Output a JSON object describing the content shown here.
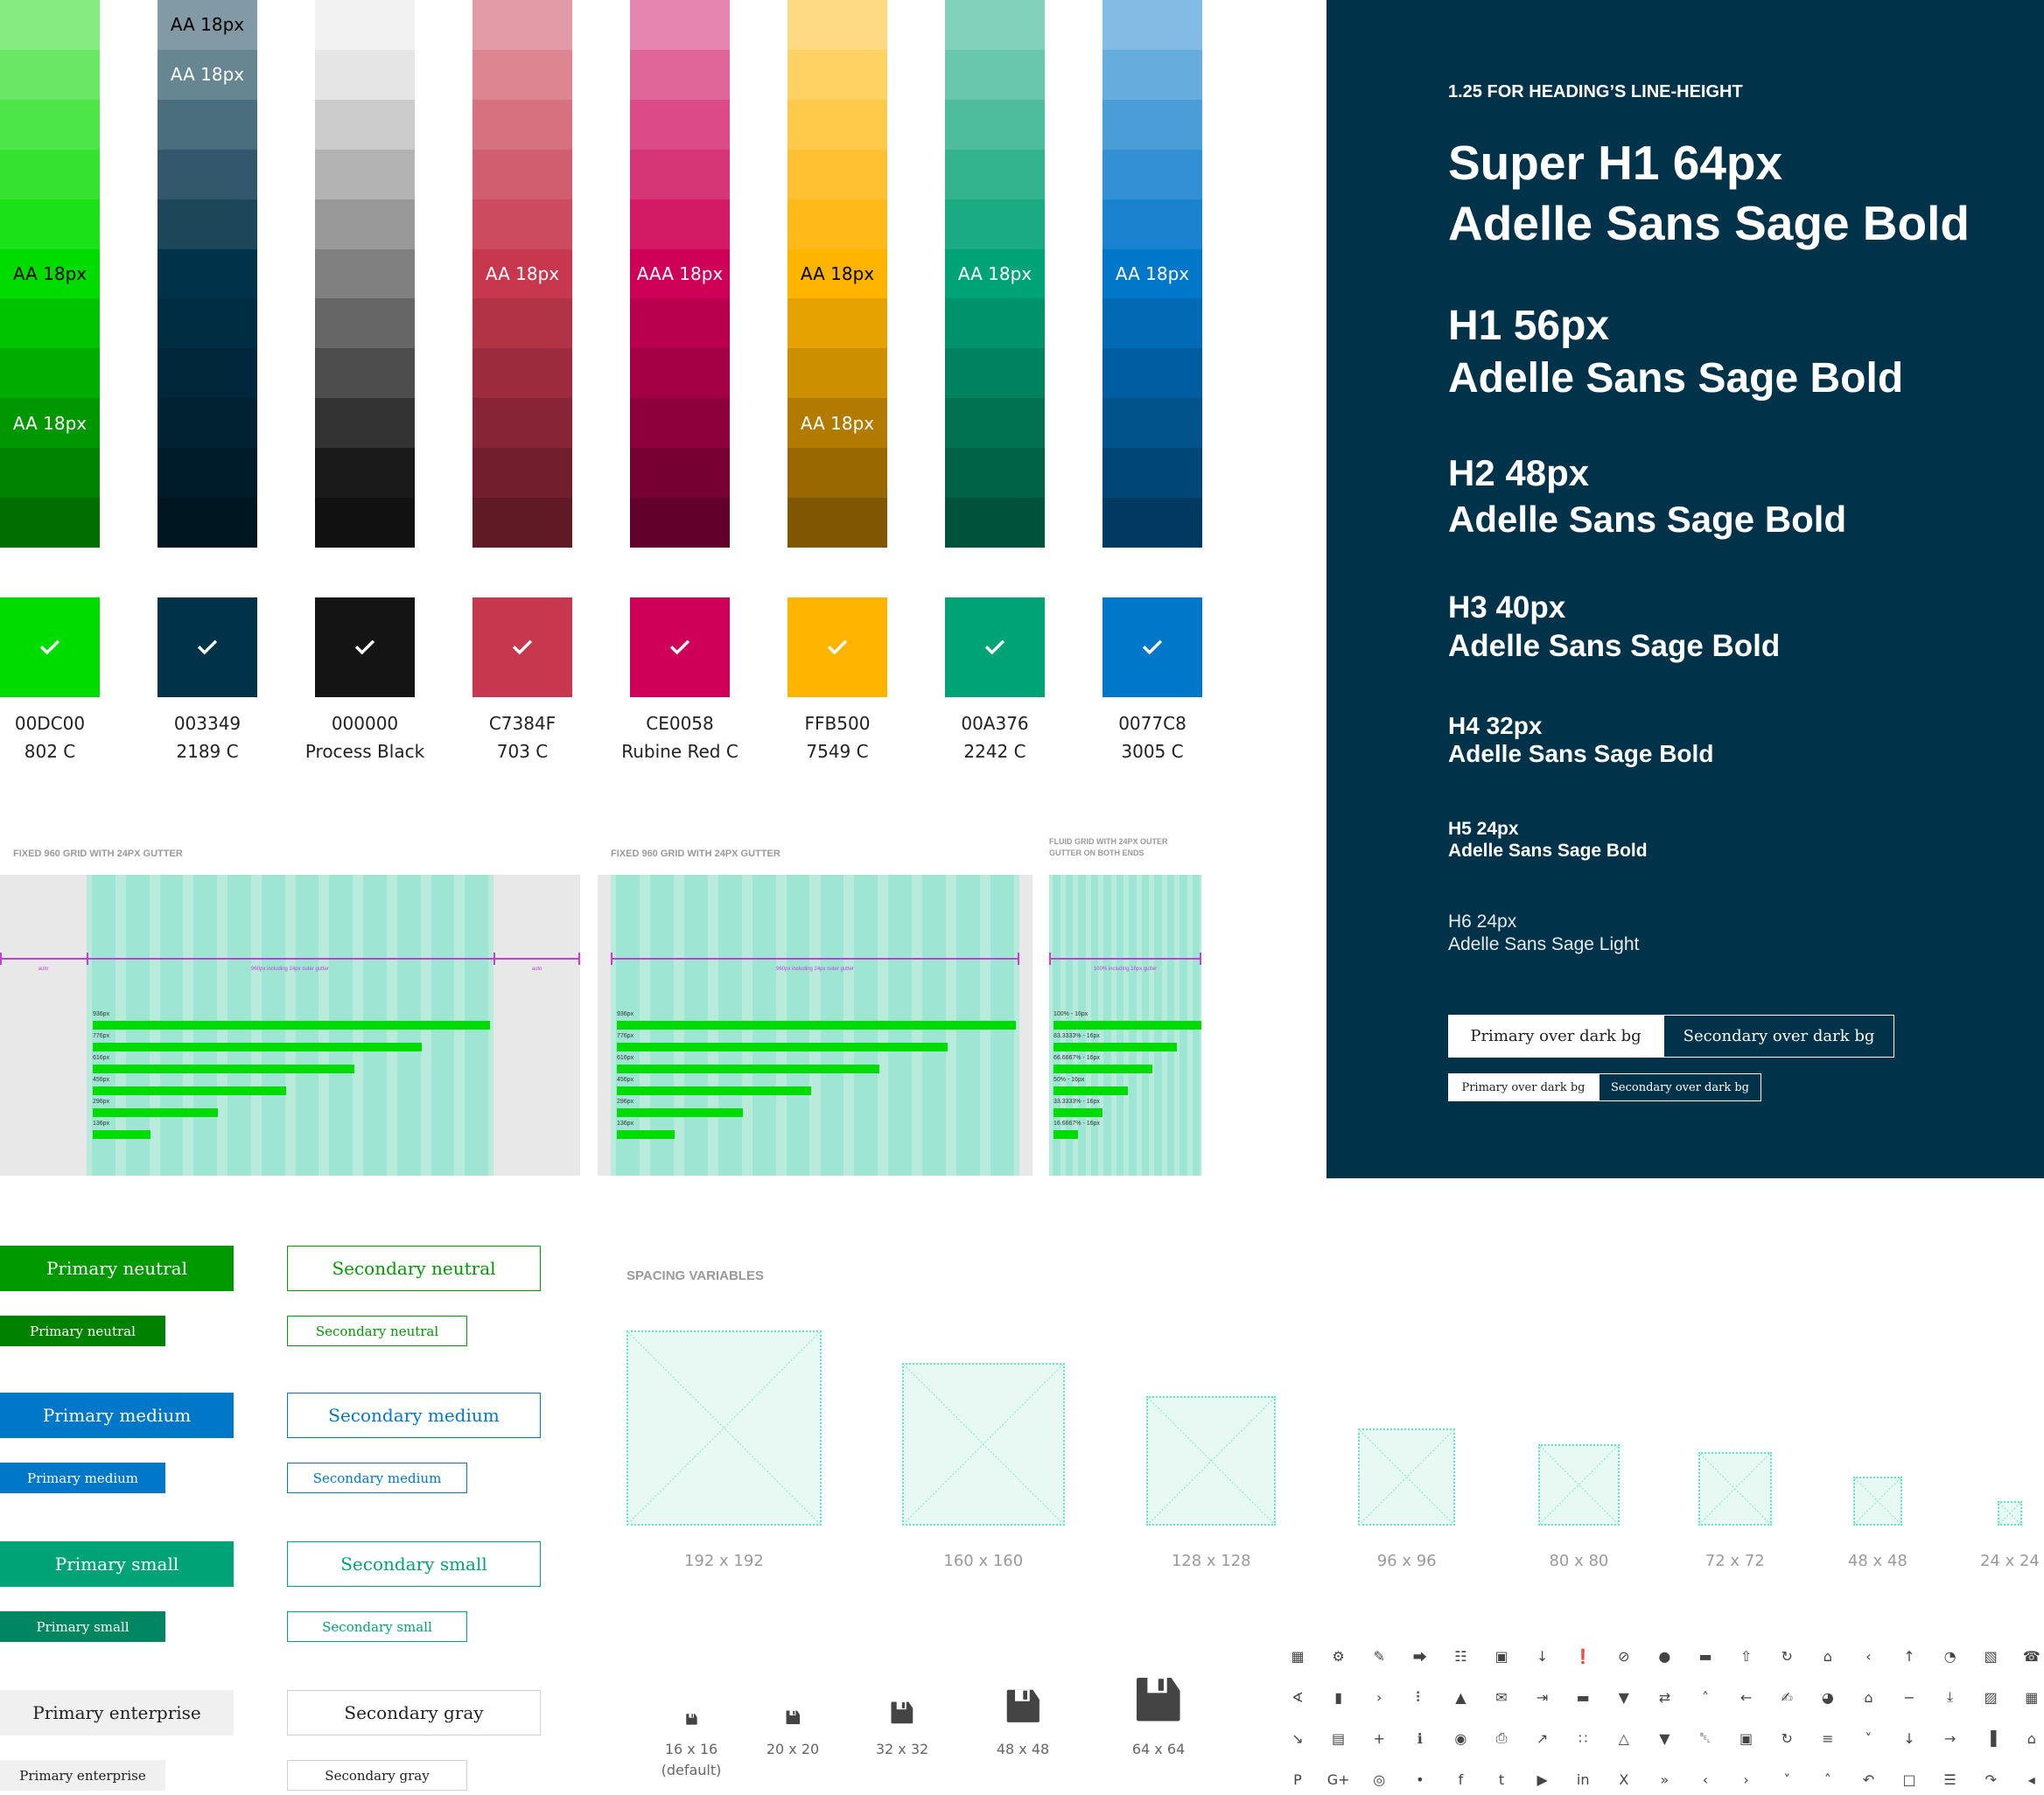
{
  "palettes": [
    {
      "name": "green",
      "steps": [
        "#86ec81",
        "#6ae765",
        "#4de648",
        "#34e22f",
        "#1be217",
        "#00dc00",
        "#00c400",
        "#00ac00",
        "#009700",
        "#008300",
        "#006e00"
      ],
      "labels": {
        "5": {
          "text": "AA 18px",
          "color": "#000000"
        },
        "8": {
          "text": "AA 18px",
          "color": "#ffffff"
        }
      },
      "main": "#00dc00",
      "hex": "00DC00",
      "pantone": "802 C"
    },
    {
      "name": "navy",
      "steps": [
        "#819aa6",
        "#668692",
        "#4b6e7e",
        "#34586b",
        "#1d4659",
        "#003349",
        "#002d42",
        "#00273a",
        "#002233",
        "#001c2b",
        "#001722"
      ],
      "labels": {
        "0": {
          "text": "AA 18px",
          "color": "#000000"
        },
        "1": {
          "text": "AA 18px",
          "color": "#ffffff"
        }
      },
      "main": "#003349",
      "hex": "003349",
      "pantone": "2189 C"
    },
    {
      "name": "gray",
      "steps": [
        "#f2f2f2",
        "#e5e5e5",
        "#cccccc",
        "#b3b3b3",
        "#999999",
        "#808080",
        "#666666",
        "#4d4d4d",
        "#333333",
        "#1a1a1a",
        "#111111"
      ],
      "labels": {},
      "main": "#141414",
      "hex": "000000",
      "pantone": "Process Black"
    },
    {
      "name": "red",
      "steps": [
        "#e39ca7",
        "#dd8692",
        "#d67280",
        "#d15e6e",
        "#cc4b5f",
        "#c7384f",
        "#b13346",
        "#9c2b3e",
        "#872436",
        "#731e2c",
        "#5f1a26"
      ],
      "labels": {
        "5": {
          "text": "AA 18px",
          "color": "#ffffff"
        }
      },
      "main": "#c7384f",
      "hex": "C7384F",
      "pantone": "703 C"
    },
    {
      "name": "rubine",
      "steps": [
        "#e685ae",
        "#e06699",
        "#db4b88",
        "#d63676",
        "#d21a65",
        "#ce0058",
        "#b8004f",
        "#a30045",
        "#8d003c",
        "#770033",
        "#62002b"
      ],
      "labels": {
        "5": {
          "text": "AAA 18px",
          "color": "#ffffff"
        }
      },
      "main": "#ce0058",
      "hex": "CE0058",
      "pantone": "Rubine Red C"
    },
    {
      "name": "yellow",
      "steps": [
        "#ffda85",
        "#ffd264",
        "#ffc94a",
        "#ffc132",
        "#ffba19",
        "#ffb500",
        "#e5a200",
        "#cc8f00",
        "#b27b00",
        "#996800",
        "#805700"
      ],
      "labels": {
        "5": {
          "text": "AA 18px",
          "color": "#000000"
        },
        "8": {
          "text": "AA 18px",
          "color": "#ffffff"
        }
      },
      "main": "#ffb500",
      "hex": "FFB500",
      "pantone": "7549 C"
    },
    {
      "name": "teal",
      "steps": [
        "#82d1bb",
        "#68c7ad",
        "#4ebd9d",
        "#33b38e",
        "#1aab83",
        "#00a376",
        "#00936a",
        "#00825e",
        "#007252",
        "#006246",
        "#00523b"
      ],
      "labels": {
        "5": {
          "text": "AA 18px",
          "color": "#ffffff"
        }
      },
      "main": "#00a376",
      "hex": "00A376",
      "pantone": "2242 C"
    },
    {
      "name": "blue",
      "steps": [
        "#82bbe3",
        "#66acdd",
        "#4b9dd7",
        "#3490d5",
        "#1a83d0",
        "#0077c8",
        "#006bb4",
        "#005ea0",
        "#00538b",
        "#004677",
        "#003a63"
      ],
      "labels": {
        "5": {
          "text": "AA 18px",
          "color": "#ffffff"
        }
      },
      "main": "#0077c8",
      "hex": "0077C8",
      "pantone": "3005 C"
    }
  ],
  "grids": [
    {
      "title": "FIXED 960 GRID WITH 24PX GUTTER",
      "measure_label": "960px including 24px outer gutter",
      "side_label": "auto",
      "bars": [
        "936px",
        "776px",
        "616px",
        "456px",
        "296px",
        "136px"
      ],
      "bar_fractions": [
        1.0,
        0.829,
        0.658,
        0.487,
        0.316,
        0.145
      ]
    },
    {
      "title": "FIXED 960 GRID WITH 24PX GUTTER",
      "measure_label": "960px including 24px outer gutter",
      "bars": [
        "936px",
        "776px",
        "616px",
        "456px",
        "296px",
        "136px"
      ],
      "bar_fractions": [
        1.0,
        0.829,
        0.658,
        0.487,
        0.316,
        0.145
      ]
    },
    {
      "title": "FLUID GRID WITH 24PX OUTER GUTTER ON BOTH ENDS",
      "measure_label": "100% including 16px gutter",
      "bars": [
        "100% - 16px",
        "83.3333% - 16px",
        "66.6667% - 16px",
        "50% - 16px",
        "33.3333% - 16px",
        "16.6667% - 16px"
      ],
      "bar_fractions": [
        1.0,
        0.833,
        0.667,
        0.5,
        0.333,
        0.167
      ]
    }
  ],
  "typography": {
    "note": "1.25 FOR HEADING’S LINE-HEIGHT",
    "headings": [
      {
        "line1": "Super H1 64px",
        "line2": "Adelle Sans Sage Bold"
      },
      {
        "line1": "H1 56px",
        "line2": "Adelle Sans Sage Bold"
      },
      {
        "line1": "H2 48px",
        "line2": "Adelle Sans Sage Bold"
      },
      {
        "line1": "H3 40px",
        "line2": "Adelle Sans Sage Bold"
      },
      {
        "line1": "H4 32px",
        "line2": "Adelle Sans Sage Bold"
      },
      {
        "line1": "H5 24px",
        "line2": "Adelle Sans Sage Bold"
      },
      {
        "line1": "H6 24px",
        "line2": "Adelle Sans Sage Light"
      }
    ],
    "dark_buttons": {
      "primary": "Primary over dark bg",
      "secondary": "Secondary over dark bg"
    }
  },
  "buttons": [
    {
      "primary": "Primary neutral",
      "secondary": "Secondary neutral",
      "primary_color": "#009900",
      "primary_small_color": "#008200",
      "secondary_color": "#009900",
      "primary_text": "#ffffff"
    },
    {
      "primary": "Primary medium",
      "secondary": "Secondary medium",
      "primary_color": "#0077c8",
      "primary_small_color": "#0077c8",
      "secondary_color": "#0077c8",
      "primary_text": "#ffffff"
    },
    {
      "primary": "Primary small",
      "secondary": "Secondary small",
      "primary_color": "#00a376",
      "primary_small_color": "#008660",
      "secondary_color": "#00a376",
      "primary_text": "#ffffff"
    },
    {
      "primary": "Primary enterprise",
      "secondary": "Secondary gray",
      "primary_color": "#f0f0f0",
      "primary_small_color": "#f0f0f0",
      "secondary_color": "#d0d0d0",
      "primary_text": "#222222",
      "secondary_text": "#222222"
    }
  ],
  "spacing": {
    "title": "SPACING VARIABLES",
    "items": [
      "192 x 192",
      "160 x 160",
      "128 x 128",
      "96 x 96",
      "80 x 80",
      "72 x 72",
      "48 x 48",
      "24 x 24"
    ],
    "sizes": [
      192,
      160,
      128,
      96,
      80,
      72,
      48,
      24
    ]
  },
  "icon_sizes": {
    "items": [
      {
        "label": "16 x 16",
        "sub": "(default)",
        "size": 16
      },
      {
        "label": "20 x 20",
        "sub": "",
        "size": 20
      },
      {
        "label": "32 x 32",
        "sub": "",
        "size": 32
      },
      {
        "label": "48 x 48",
        "sub": "",
        "size": 48
      },
      {
        "label": "64 x 64",
        "sub": "",
        "size": 64
      }
    ]
  },
  "icons": [
    [
      "calendar-icon",
      "gear-icon",
      "pencil-icon",
      "share-icon",
      "comments-icon",
      "copy-icon",
      "arrow-down-small-icon",
      "alert-circle-icon",
      "block-icon",
      "user-icon",
      "chat-icon",
      "upload-box-icon",
      "refresh-icon",
      "basket-icon",
      "chevron-left-icon",
      "arrow-up-icon",
      "spinner-icon",
      "no-image-icon",
      "phone-icon"
    ],
    [
      "paperclip-icon",
      "trash-icon",
      "chevron-right-icon",
      "drag-handle-icon",
      "lock-icon",
      "mail-icon",
      "sign-out-icon",
      "credit-card-icon",
      "filter-icon",
      "shuffle-icon",
      "chevron-up-icon",
      "arrow-left-icon",
      "edit-square-icon",
      "pie-chart-icon",
      "store-icon",
      "minus-icon",
      "download-icon",
      "image-icon",
      "table-icon"
    ],
    [
      "line-chart-icon",
      "briefcase-icon",
      "plus-icon",
      "info-icon",
      "camera-icon",
      "printer-icon",
      "external-link-icon",
      "dots-grid-icon",
      "unlock-icon",
      "map-pin-icon",
      "bell-icon",
      "save-icon",
      "redo-circle-icon",
      "sliders-icon",
      "chevron-down-icon",
      "arrow-down-icon",
      "arrow-right-circle-icon",
      "bar-chart-icon",
      "home-icon"
    ],
    [
      "pinterest-icon",
      "google-plus-icon",
      "instagram-icon",
      "twitter-icon",
      "facebook-icon",
      "tumblr-icon",
      "youtube-icon",
      "linkedin-icon",
      "xing-icon",
      "double-chevron-right-icon",
      "small-chevron-left-icon",
      "small-chevron-right-icon",
      "small-chevron-down-icon",
      "small-chevron-up-icon",
      "undo-icon",
      "file-icon",
      "document-icon",
      "redo-icon",
      "caret-left-icon"
    ]
  ],
  "icon_glyphs": [
    [
      "▦",
      "⚙",
      "✎",
      "⮕",
      "☷",
      "▣",
      "↓",
      "❗",
      "⊘",
      "●",
      "▬",
      "⇧",
      "↻",
      "⌂",
      "‹",
      "↑",
      "◔",
      "▧",
      "☎"
    ],
    [
      "∢",
      "▮",
      "›",
      "⠇",
      "▲",
      "✉",
      "⇥",
      "▬",
      "▼",
      "⇄",
      "˄",
      "←",
      "✍",
      "◕",
      "⌂",
      "−",
      "⤓",
      "▨",
      "▦"
    ],
    [
      "↘",
      "▤",
      "+",
      "ℹ",
      "◉",
      "⎙",
      "↗",
      "∷",
      "△",
      "▼",
      "␇",
      "▣",
      "↻",
      "≡",
      "˅",
      "↓",
      "→",
      "▐",
      "⌂"
    ],
    [
      "P",
      "G+",
      "◎",
      "•",
      "f",
      "t",
      "▶",
      "in",
      "X",
      "»",
      "‹",
      "›",
      "˅",
      "˄",
      "↶",
      "□",
      "☰",
      "↷",
      "◂"
    ]
  ]
}
